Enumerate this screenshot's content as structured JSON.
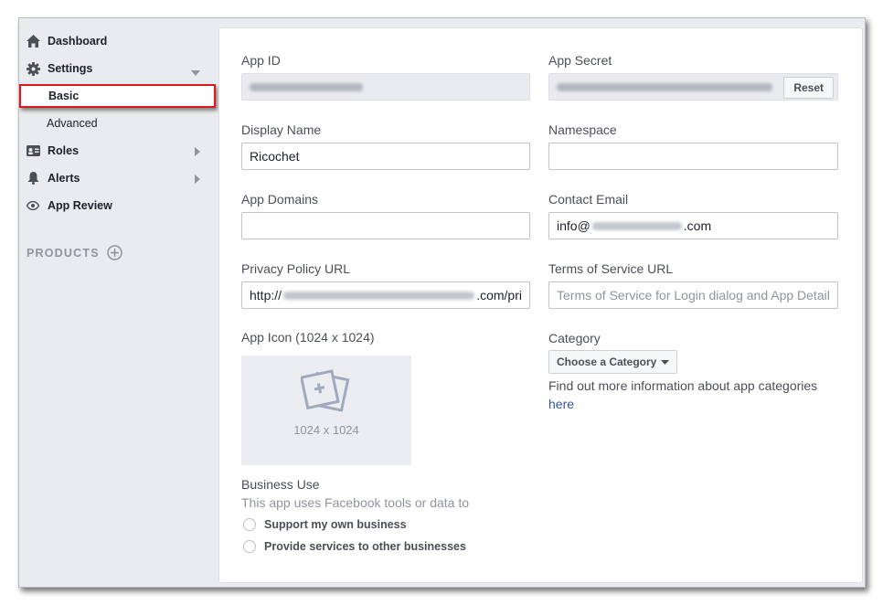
{
  "sidebar": {
    "dashboard": "Dashboard",
    "settings": "Settings",
    "basic": "Basic",
    "advanced": "Advanced",
    "roles": "Roles",
    "alerts": "Alerts",
    "app_review": "App Review",
    "products": "PRODUCTS"
  },
  "form": {
    "app_id_label": "App ID",
    "app_secret_label": "App Secret",
    "reset_label": "Reset",
    "display_name_label": "Display Name",
    "display_name_value": "Ricochet",
    "namespace_label": "Namespace",
    "app_domains_label": "App Domains",
    "contact_email_label": "Contact Email",
    "contact_email_prefix": "info@",
    "contact_email_suffix": ".com",
    "privacy_label": "Privacy Policy URL",
    "privacy_prefix": "http://",
    "privacy_suffix": ".com/pri",
    "tos_label": "Terms of Service URL",
    "tos_placeholder": "Terms of Service for Login dialog and App Detail",
    "app_icon_label": "App Icon (1024 x 1024)",
    "app_icon_size": "1024 x 1024",
    "category_label": "Category",
    "category_button": "Choose a Category",
    "category_info": "Find out more information about app categories",
    "category_link": "here",
    "business_use_label": "Business Use",
    "business_use_desc": "This app uses Facebook tools or data to",
    "option_own": "Support my own business",
    "option_others": "Provide services to other businesses"
  },
  "colors": {
    "highlight": "#e3161d",
    "link": "#365899",
    "sidebar_bg": "#e9ebee"
  }
}
